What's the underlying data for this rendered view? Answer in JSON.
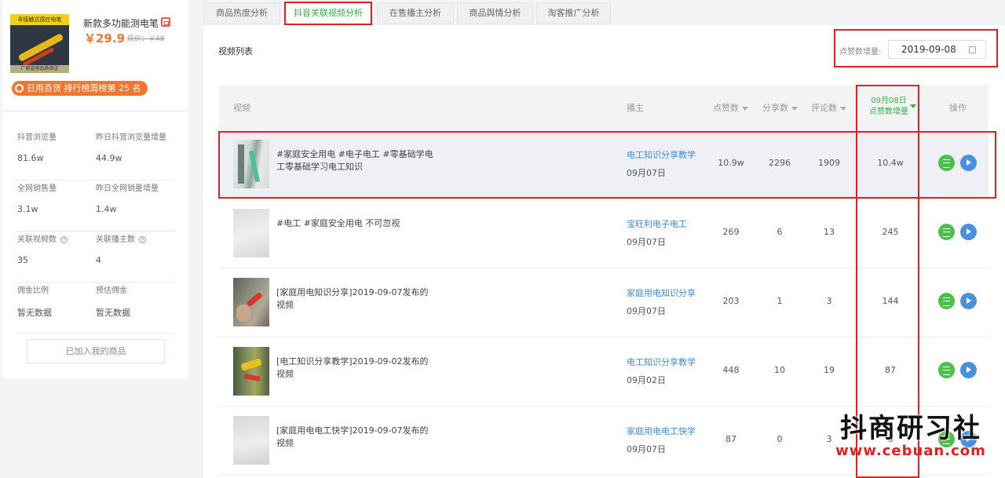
{
  "product": {
    "title": "新款多功能测电笔",
    "price": "￥29.9",
    "original_price": "原价：￥48",
    "rank_text": "日用百货 排行榜周榜第 25 名",
    "thumb_top_text": "非接触式感应电笔",
    "thumb_bottom_text": "厂家直销品质保证"
  },
  "stats": [
    {
      "label": "抖音浏览量",
      "value": "81.6w",
      "label2": "昨日抖音浏览量增量",
      "value2": "44.9w"
    },
    {
      "label": "全网销售量",
      "value": "3.1w",
      "label2": "昨日全网销量增量",
      "value2": "1.4w"
    },
    {
      "label": "关联视频数",
      "value": "35",
      "label2": "关联播主数",
      "value2": "4"
    },
    {
      "label": "佣金比例",
      "value": "暂无数据",
      "label2": "预估佣金",
      "value2": "暂无数据"
    }
  ],
  "added_button": "已加入我的商品",
  "tabs": [
    "商品热度分析",
    "抖音关联视频分析",
    "在售播主分析",
    "商品舆情分析",
    "淘客推广分析"
  ],
  "list_title": "视频列表",
  "date_filter": {
    "label": "点赞数增量:",
    "value": "2019-09-08"
  },
  "table": {
    "headers": {
      "video": "视频",
      "blogger": "播主",
      "likes": "点赞数",
      "shares": "分享数",
      "comments": "评论数",
      "incr_date": "09月08日",
      "incr_label": "点赞数增量",
      "ops": "操作"
    },
    "rows": [
      {
        "text": "#家庭安全用电 #电子电工 #零基础学电工零基础学习电工知识",
        "blogger": "电工知识分享教学",
        "date": "09月07日",
        "likes": "10.9w",
        "shares": "2296",
        "comments": "1909",
        "incr": "10.4w"
      },
      {
        "text": "#电工 #家庭安全用电 不可忽视",
        "blogger": "宝旺利电子电工",
        "date": "09月07日",
        "likes": "269",
        "shares": "6",
        "comments": "13",
        "incr": "245"
      },
      {
        "text": "[家庭用电知识分享]2019-09-07发布的视频",
        "blogger": "家庭用电知识分享",
        "date": "09月07日",
        "likes": "203",
        "shares": "1",
        "comments": "3",
        "incr": "144"
      },
      {
        "text": "[电工知识分享教学]2019-09-02发布的视频",
        "blogger": "电工知识分享教学",
        "date": "09月02日",
        "likes": "448",
        "shares": "10",
        "comments": "19",
        "incr": "87"
      },
      {
        "text": "[家庭用电电工快学]2019-09-07发布的视频",
        "blogger": "家庭用电电工快学",
        "date": "09月07日",
        "likes": "87",
        "shares": "0",
        "comments": "3",
        "incr": "6"
      }
    ]
  },
  "watermark": {
    "name": "抖商研习社",
    "url": "www.cebuan.com"
  }
}
